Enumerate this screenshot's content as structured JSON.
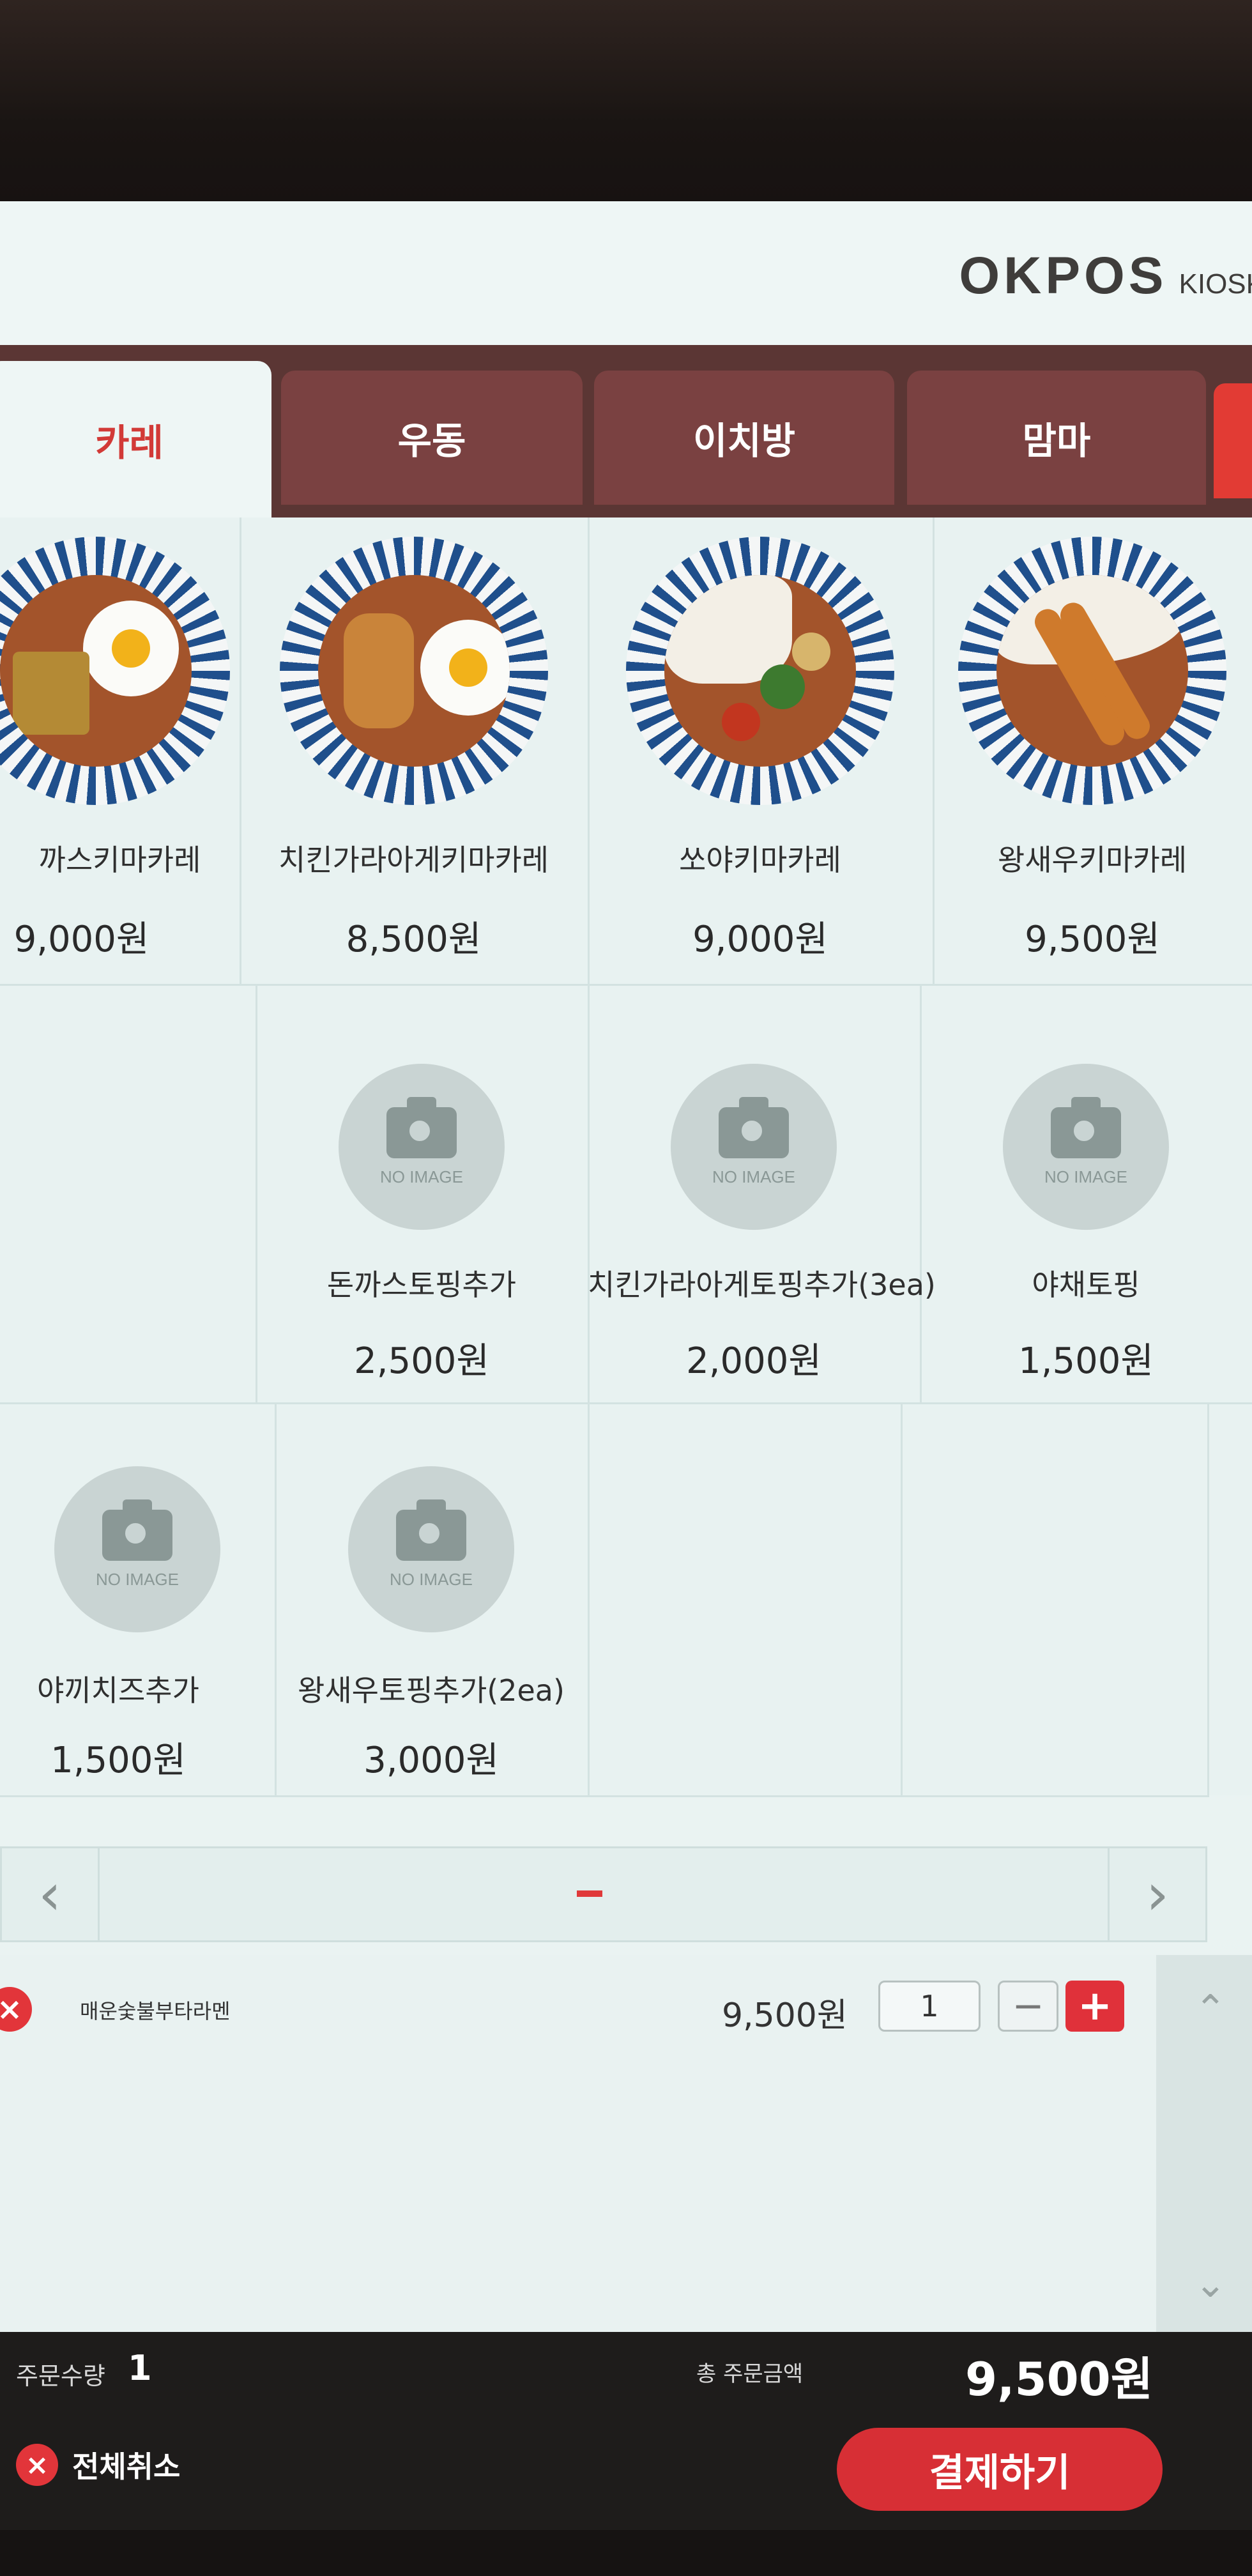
{
  "header": {
    "brand": "OKPOS",
    "brand_suffix": "KIOSK"
  },
  "tabs": [
    {
      "label": "카레",
      "active": true
    },
    {
      "label": "우동",
      "active": false
    },
    {
      "label": "이치방",
      "active": false
    },
    {
      "label": "맘마",
      "active": false
    }
  ],
  "menu": {
    "no_image_text": "NO IMAGE",
    "items": [
      {
        "name": "까스키마카레",
        "price": "9,000원",
        "image": "katsu-keema-curry"
      },
      {
        "name": "치킨가라아게키마카레",
        "price": "8,500원",
        "image": "karaage-keema-curry"
      },
      {
        "name": "쏘야키마카레",
        "price": "9,000원",
        "image": "soya-keema-curry"
      },
      {
        "name": "왕새우키마카레",
        "price": "9,500원",
        "image": "shrimp-keema-curry"
      },
      {
        "name": "돈까스토핑추가",
        "price": "2,500원",
        "image": "none"
      },
      {
        "name": "치킨가라아게토핑추가(3ea)",
        "price": "2,000원",
        "image": "none"
      },
      {
        "name": "야채토핑",
        "price": "1,500원",
        "image": "none"
      },
      {
        "name": "야끼치즈추가",
        "price": "1,500원",
        "image": "none"
      },
      {
        "name": "왕새우토핑추가(2ea)",
        "price": "3,000원",
        "image": "none"
      }
    ]
  },
  "pager": {
    "prev_icon": "chevron-left-icon",
    "next_icon": "chevron-right-icon"
  },
  "cart": {
    "items": [
      {
        "name": "매운숯불부타라멘",
        "price": "9,500원",
        "quantity": "1"
      }
    ]
  },
  "footer": {
    "order_qty_label": "주문수량",
    "order_qty": "1",
    "total_label": "총 주문금액",
    "total": "9,500원",
    "cancel_all": "전체취소",
    "pay": "결제하기"
  },
  "colors": {
    "accent": "#d72f35",
    "tab_bg": "#7a4141",
    "tabbar_bg": "#5b3634"
  }
}
